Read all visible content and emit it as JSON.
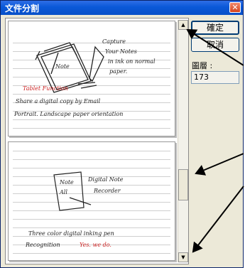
{
  "window": {
    "title": "文件分割",
    "close_glyph": "✕"
  },
  "buttons": {
    "ok_label": "確定",
    "cancel_label": "取消"
  },
  "pages_panel": {
    "label": "圖層 :",
    "value": "173"
  },
  "scrollbar": {
    "up_glyph": "▲",
    "down_glyph": "▼"
  },
  "page1": {
    "lines": [
      "Capture",
      "Your Notes",
      "in ink on normal",
      "paper.",
      "Tablet Function",
      "Share a digital copy by Email",
      "Portrait. Landscape paper orientation"
    ]
  },
  "page2": {
    "lines": [
      "Note",
      "Digital Note",
      "All",
      "Recorder",
      "Three color digital inking pen",
      "Recognition",
      "Yes. we do."
    ]
  },
  "colors": {
    "title_bar": "#0a58d8",
    "dialog_bg": "#ece9d8",
    "red_ink": "#cc2222"
  }
}
